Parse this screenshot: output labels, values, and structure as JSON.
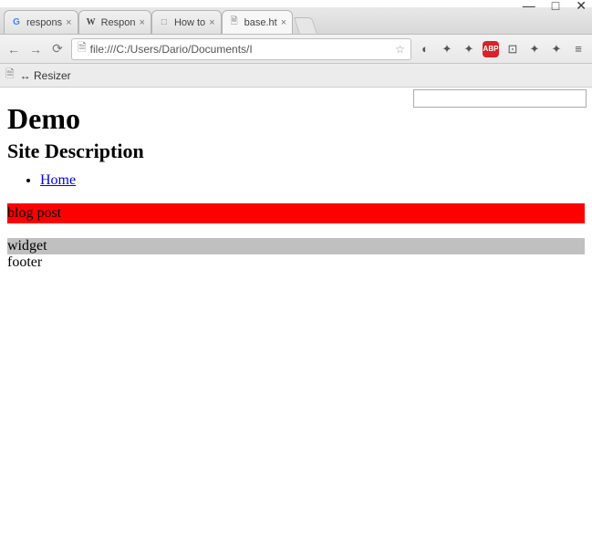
{
  "window": {
    "minimize": "—",
    "maximize": "□",
    "close": "✕"
  },
  "tabs": [
    {
      "favicon": "G",
      "favicon_color": "#4285f4",
      "title": "respons"
    },
    {
      "favicon": "W",
      "favicon_color": "#444",
      "title": "Respon"
    },
    {
      "favicon": "□",
      "favicon_color": "#888",
      "title": "How to"
    },
    {
      "favicon": "🗎",
      "favicon_color": "#888",
      "title": "base.ht"
    }
  ],
  "toolbar": {
    "back": "←",
    "forward": "→",
    "reload": "⟳",
    "file_icon": "🗎",
    "url": "file:///C:/Users/Dario/Documents/I",
    "star": "☆",
    "menu": "≡",
    "abp": "ABP"
  },
  "bookmarks": {
    "file_icon": "🗎",
    "resizer_label": "↔ Resizer"
  },
  "page": {
    "heading": "Demo",
    "subheading": "Site Description",
    "nav_home": "Home",
    "blog_post": "blog post",
    "widget": "widget",
    "footer": "footer"
  }
}
